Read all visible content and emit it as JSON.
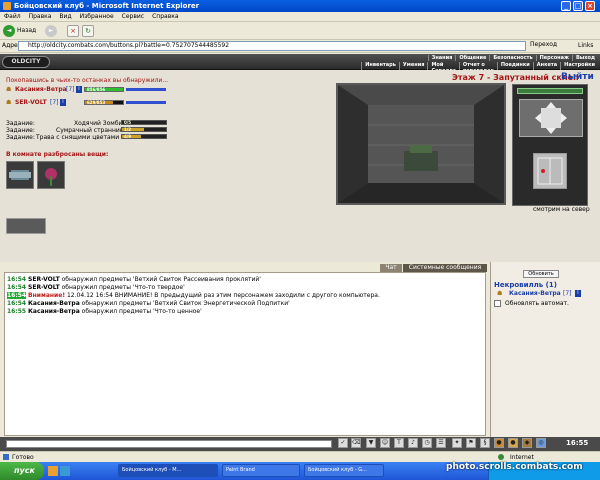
{
  "window": {
    "title": "Бойцовский клуб - Microsoft Internet Explorer"
  },
  "menu": [
    "Файл",
    "Правка",
    "Вид",
    "Избранное",
    "Сервис",
    "Справка"
  ],
  "toolbar": {
    "back": "Назад"
  },
  "address": {
    "label": "Адрес:",
    "url": "http://oldcity.combats.com/buttons.pl?battle=0.752707544485592",
    "go": "Переход",
    "links": "Links"
  },
  "game": {
    "logo": "OLDCITY",
    "nav_row1": [
      "Знания",
      "Общение",
      "Безопасность",
      "Персонаж",
      "Выход"
    ],
    "nav_row2": [
      "Инвентарь",
      "Умения",
      "Мой Скроллс",
      "Отчет о переводах",
      "Поединки",
      "Анкета",
      "Настройки"
    ],
    "location": "Этаж 7 - Запутанный склеп",
    "exit": "Выйти",
    "intro": "Покопавшись в чьих-то останках вы обнаружили...",
    "players": [
      {
        "name": "Касания-Ветра",
        "level": "[7]",
        "hp": "856/856",
        "hp_pct": 100,
        "color": "#2fbf2f"
      },
      {
        "name": "SER-VOLT",
        "level": "[7]",
        "hp": "629/853",
        "hp_pct": 74,
        "color": "#c08a1c"
      }
    ],
    "task_label": "Задание:",
    "tasks": [
      {
        "name": "Ходячий Зомби",
        "value": "0/5"
      },
      {
        "name": "Сумрачный странник",
        "value": "1/2"
      },
      {
        "name": "Трава с снящими цветами",
        "value": "4/9"
      }
    ],
    "items_heading": "В комнате разбросаны вещи:",
    "view_caption": "смотрим на север"
  },
  "chat": {
    "tabs": [
      "Чат",
      "Системные сообщения"
    ],
    "lines": [
      {
        "time": "16:54",
        "who": "SER-VOLT",
        "text": "обнаружил предметы 'Ветхий Свиток Рассеивания проклятий'"
      },
      {
        "time": "16:54",
        "who": "SER-VOLT",
        "text": "обнаружил предметы 'Что-то твердое'"
      },
      {
        "time": "16:54",
        "who": "Внимание!",
        "text": "12.04.12 16:54 ВНИМАНИЕ! В предыдущий раз этим персонажем заходили с другого компьютера."
      },
      {
        "time": "16:54",
        "who": "Касания-Ветра",
        "text": "обнаружил предметы 'Ветхий Свиток Энергетической Подпитки'"
      },
      {
        "time": "16:55",
        "who": "Касания-Ветра",
        "text": "обнаружил предметы 'Что-то ценное'"
      }
    ]
  },
  "side": {
    "refresh": "Обновить",
    "room": "Некровилль (1)",
    "member": "Касания-Ветра",
    "member_level": "[7]",
    "auto": "Обновлять автомат."
  },
  "bottom": {
    "clock": "16:55"
  },
  "status": {
    "left": "Готово",
    "right": "Internet"
  },
  "taskbar": {
    "start": "пуск",
    "tasks": [
      "Бойцовский клуб - M...",
      "Paint Brand",
      "Бойцовский клуб - G..."
    ],
    "watermark": "photo.scrolls.combats.com"
  },
  "colors": {
    "xp_blue": "#0a5fe0",
    "title_red": "#a31515",
    "link_blue": "#1a3ea8"
  }
}
